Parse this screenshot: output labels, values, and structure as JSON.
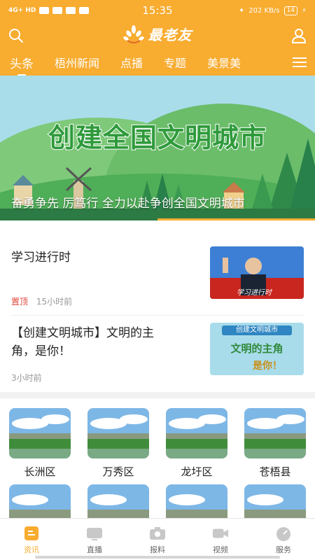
{
  "colors": {
    "accent": "#f8ac30",
    "pin_red": "#e0453a",
    "green": "#2f9a3c"
  },
  "status_bar": {
    "network": "4G+ HD",
    "time": "15:35",
    "speed": "202 KB/s",
    "battery": "14"
  },
  "header": {
    "logo_text": "最老友",
    "search_icon": "search-icon",
    "user_icon": "user-icon"
  },
  "tabs": [
    {
      "label": "头条",
      "active": true
    },
    {
      "label": "梧州新闻"
    },
    {
      "label": "点播"
    },
    {
      "label": "专题"
    },
    {
      "label": "美景美"
    }
  ],
  "banner": {
    "title": "创建全国文明城市",
    "caption": "奋勇争先 厉笃行 全力以赴争创全国文明城市"
  },
  "news": [
    {
      "title": "学习进行时",
      "tag": "置顶",
      "time": "15小时前",
      "thumb_text": "学习进行时"
    },
    {
      "title_line1": "【创建文明城市】文明的主",
      "title_line2": "角，是你！",
      "time": "3小时前",
      "thumb_line1": "创建文明城市",
      "thumb_line2": "文明的主角",
      "thumb_line3": "是你！"
    }
  ],
  "districts": [
    {
      "name": "长洲区"
    },
    {
      "name": "万秀区"
    },
    {
      "name": "龙圩区"
    },
    {
      "name": "苍梧县"
    }
  ],
  "bottom_nav": [
    {
      "label": "资讯",
      "icon": "news-icon",
      "active": true
    },
    {
      "label": "直播",
      "icon": "tv-icon"
    },
    {
      "label": "报料",
      "icon": "camera-icon"
    },
    {
      "label": "视频",
      "icon": "video-icon"
    },
    {
      "label": "服务",
      "icon": "service-icon"
    }
  ]
}
